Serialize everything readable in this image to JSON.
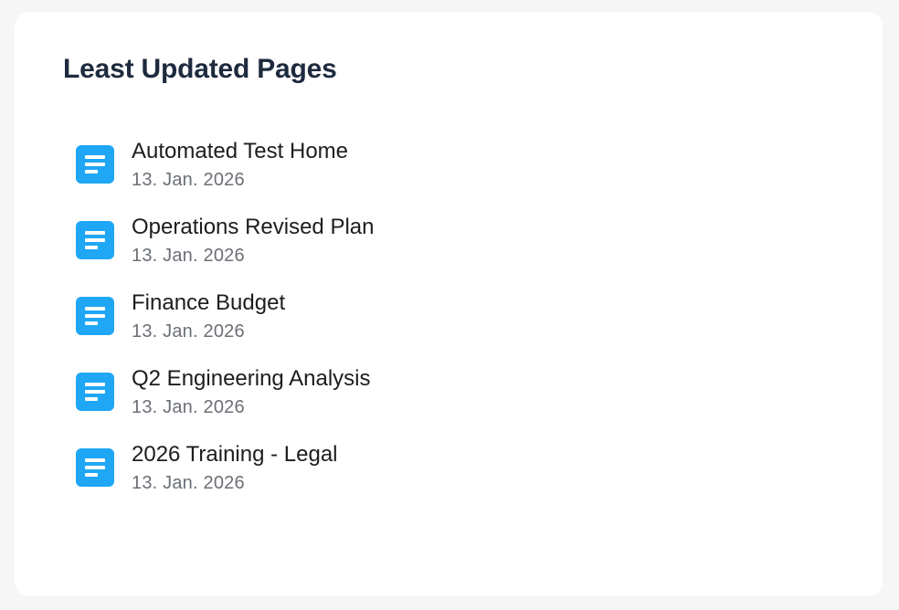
{
  "widget": {
    "title": "Least Updated Pages"
  },
  "pages": [
    {
      "name": "Automated Test Home",
      "date": "13. Jan. 2026",
      "icon": "document-icon"
    },
    {
      "name": "Operations Revised Plan",
      "date": "13. Jan. 2026",
      "icon": "document-icon"
    },
    {
      "name": "Finance Budget",
      "date": "13. Jan. 2026",
      "icon": "document-icon"
    },
    {
      "name": "Q2 Engineering Analysis",
      "date": "13. Jan. 2026",
      "icon": "document-icon"
    },
    {
      "name": "2026 Training - Legal",
      "date": "13. Jan. 2026",
      "icon": "document-icon"
    }
  ],
  "colors": {
    "icon_background": "#1fa7f5",
    "title_text": "#1e2a3e",
    "date_text": "#6b6f76",
    "page_background": "#f6f6f7",
    "card_background": "#ffffff"
  }
}
